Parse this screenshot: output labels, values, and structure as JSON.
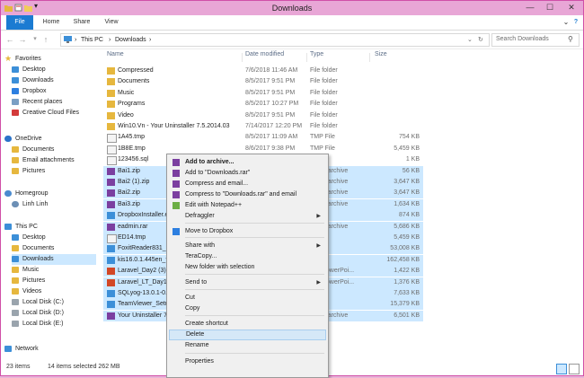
{
  "window": {
    "title": "Downloads",
    "minimize": "—",
    "maximize": "☐",
    "close": "✕"
  },
  "ribbon": {
    "tabs": [
      "File",
      "Home",
      "Share",
      "View"
    ]
  },
  "address": {
    "back": "←",
    "forward": "→",
    "up": "↑",
    "separator": "›",
    "crumbs": [
      "This PC",
      "Downloads"
    ],
    "search_placeholder": "Search Downloads"
  },
  "nav": [
    {
      "label": "Favorites",
      "icon": "star-icon"
    },
    {
      "label": "Desktop",
      "icon": "desktop-icon"
    },
    {
      "label": "Downloads",
      "icon": "downloads-icon"
    },
    {
      "label": "Dropbox",
      "icon": "dropbox-icon"
    },
    {
      "label": "Recent places",
      "icon": "recent-icon"
    },
    {
      "label": "Creative Cloud Files",
      "icon": "creative-cloud-icon"
    },
    {
      "label": "OneDrive",
      "icon": "onedrive-icon"
    },
    {
      "label": "Documents",
      "icon": "folder-icon"
    },
    {
      "label": "Email attachments",
      "icon": "folder-icon"
    },
    {
      "label": "Pictures",
      "icon": "folder-icon"
    },
    {
      "label": "Homegroup",
      "icon": "homegroup-icon"
    },
    {
      "label": "Linh Linh",
      "icon": "user-icon"
    },
    {
      "label": "This PC",
      "icon": "computer-icon"
    },
    {
      "label": "Desktop",
      "icon": "desktop-icon"
    },
    {
      "label": "Documents",
      "icon": "folder-icon"
    },
    {
      "label": "Downloads",
      "icon": "downloads-icon"
    },
    {
      "label": "Music",
      "icon": "music-icon"
    },
    {
      "label": "Pictures",
      "icon": "pictures-icon"
    },
    {
      "label": "Videos",
      "icon": "videos-icon"
    },
    {
      "label": "Local Disk (C:)",
      "icon": "disk-icon"
    },
    {
      "label": "Local Disk (D:)",
      "icon": "disk-icon"
    },
    {
      "label": "Local Disk (E:)",
      "icon": "disk-icon"
    },
    {
      "label": "Network",
      "icon": "network-icon"
    }
  ],
  "columns": {
    "name": "Name",
    "date": "Date modified",
    "type": "Type",
    "size": "Size"
  },
  "files": [
    {
      "name": "Compressed",
      "date": "7/6/2018 11:46 AM",
      "type": "File folder",
      "size": "",
      "icon": "folder-icon"
    },
    {
      "name": "Documents",
      "date": "8/5/2017 9:51 PM",
      "type": "File folder",
      "size": "",
      "icon": "folder-icon"
    },
    {
      "name": "Music",
      "date": "8/5/2017 9:51 PM",
      "type": "File folder",
      "size": "",
      "icon": "folder-icon"
    },
    {
      "name": "Programs",
      "date": "8/5/2017 10:27 PM",
      "type": "File folder",
      "size": "",
      "icon": "folder-icon"
    },
    {
      "name": "Video",
      "date": "8/5/2017 9:51 PM",
      "type": "File folder",
      "size": "",
      "icon": "folder-icon"
    },
    {
      "name": "Win10.Vn - Your Uninstaller 7.5.2014.03",
      "date": "7/14/2017 12:20 PM",
      "type": "File folder",
      "size": "",
      "icon": "folder-icon"
    },
    {
      "name": "1A45.tmp",
      "date": "8/5/2017 11:09 AM",
      "type": "TMP File",
      "size": "754 KB",
      "icon": "file-icon"
    },
    {
      "name": "1B8E.tmp",
      "date": "8/6/2017 9:38 PM",
      "type": "TMP File",
      "size": "5,459 KB",
      "icon": "file-icon"
    },
    {
      "name": "123456.sql",
      "date": "",
      "type": "",
      "size": "1 KB",
      "icon": "file-icon"
    },
    {
      "name": "Bai1.zip",
      "date": "",
      "type": "R ZIP archive",
      "size": "56 KB",
      "icon": "zip-icon"
    },
    {
      "name": "Bai2 (1).zip",
      "date": "",
      "type": "R ZIP archive",
      "size": "3,647 KB",
      "icon": "zip-icon"
    },
    {
      "name": "Bai2.zip",
      "date": "",
      "type": "R ZIP archive",
      "size": "3,647 KB",
      "icon": "zip-icon"
    },
    {
      "name": "Bai3.zip",
      "date": "",
      "type": "R ZIP archive",
      "size": "1,634 KB",
      "icon": "zip-icon"
    },
    {
      "name": "DropboxInstaller.e",
      "date": "",
      "type": "ation",
      "size": "874 KB",
      "icon": "app-icon"
    },
    {
      "name": "eadmin.rar",
      "date": "",
      "type": "R ZIP archive",
      "size": "5,686 KB",
      "icon": "zip-icon"
    },
    {
      "name": "ED14.tmp",
      "date": "",
      "type": "ile",
      "size": "5,459 KB",
      "icon": "file-icon"
    },
    {
      "name": "FoxitReader831_e",
      "date": "",
      "type": "ation",
      "size": "53,008 KB",
      "icon": "app-icon"
    },
    {
      "name": "kis16.0.1.445en_fu",
      "date": "",
      "type": "ation",
      "size": "162,458 KB",
      "icon": "app-icon"
    },
    {
      "name": "Laravel_Day2 (3).p",
      "date": "",
      "type": "soft PowerPoi...",
      "size": "1,422 KB",
      "icon": "ppt-icon"
    },
    {
      "name": "Laravel_LT_Day1.p",
      "date": "",
      "type": "soft PowerPoi...",
      "size": "1,376 KB",
      "icon": "ppt-icon"
    },
    {
      "name": "SQLyog-13.0.1-0.",
      "date": "",
      "type": "ation",
      "size": "7,633 KB",
      "icon": "app-icon"
    },
    {
      "name": "TeamViewer_Setup",
      "date": "",
      "type": "ation",
      "size": "15,379 KB",
      "icon": "app-icon"
    },
    {
      "name": "Your Uninstaller 7.",
      "date": "",
      "type": "R ZIP archive",
      "size": "6,501 KB",
      "icon": "zip-icon"
    }
  ],
  "context_menu": [
    {
      "label": "Add to archive...",
      "icon": "winrar-icon",
      "bold": true
    },
    {
      "label": "Add to \"Downloads.rar\"",
      "icon": "winrar-icon"
    },
    {
      "label": "Compress and email...",
      "icon": "winrar-icon"
    },
    {
      "label": "Compress to \"Downloads.rar\" and email",
      "icon": "winrar-icon"
    },
    {
      "label": "Edit with Notepad++",
      "icon": "notepad-icon"
    },
    {
      "label": "Defraggler",
      "icon": "",
      "submenu": true
    },
    {
      "label": "Move to Dropbox",
      "icon": "dropbox-icon"
    },
    {
      "label": "Share with",
      "icon": "",
      "submenu": true
    },
    {
      "label": "TeraCopy...",
      "icon": ""
    },
    {
      "label": "New folder with selection",
      "icon": ""
    },
    {
      "label": "Send to",
      "icon": "",
      "submenu": true
    },
    {
      "label": "Cut",
      "icon": ""
    },
    {
      "label": "Copy",
      "icon": ""
    },
    {
      "label": "Create shortcut",
      "icon": ""
    },
    {
      "label": "Delete",
      "icon": "",
      "highlighted": true
    },
    {
      "label": "Rename",
      "icon": ""
    },
    {
      "label": "Properties",
      "icon": ""
    }
  ],
  "status": {
    "items": "23 items",
    "selected": "14 items selected  262 MB"
  },
  "colors": {
    "accent": "#1b7bd2",
    "selection": "#cce8ff",
    "title_bar": "#e8a6d6"
  }
}
